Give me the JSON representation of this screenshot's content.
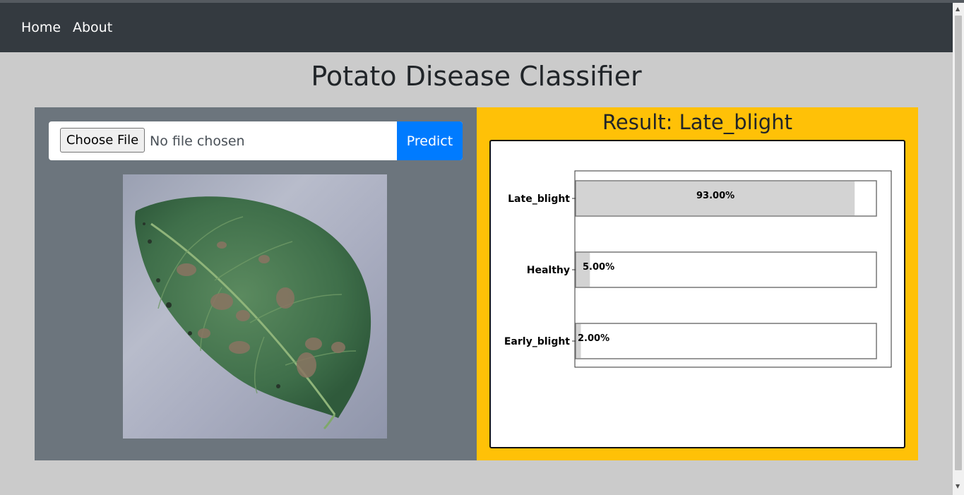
{
  "nav": {
    "items": [
      {
        "label": "Home"
      },
      {
        "label": "About"
      }
    ]
  },
  "page": {
    "title": "Potato Disease Classifier"
  },
  "upload": {
    "choose_label": "Choose File",
    "status": "No file chosen",
    "predict_label": "Predict"
  },
  "result": {
    "title": "Result: Late_blight"
  },
  "colors": {
    "navbar": "#343a40",
    "left_panel": "#6c757d",
    "right_panel": "#ffc107",
    "predict_button": "#007bff",
    "bar_fill": "#d3d3d3"
  },
  "chart_data": {
    "type": "bar",
    "orientation": "horizontal",
    "categories": [
      "Late_blight",
      "Healthy",
      "Early_blight"
    ],
    "values": [
      93.0,
      5.0,
      2.0
    ],
    "value_labels": [
      "93.00%",
      "5.00%",
      "2.00%"
    ],
    "xlim": [
      0,
      100
    ],
    "grid": false
  }
}
